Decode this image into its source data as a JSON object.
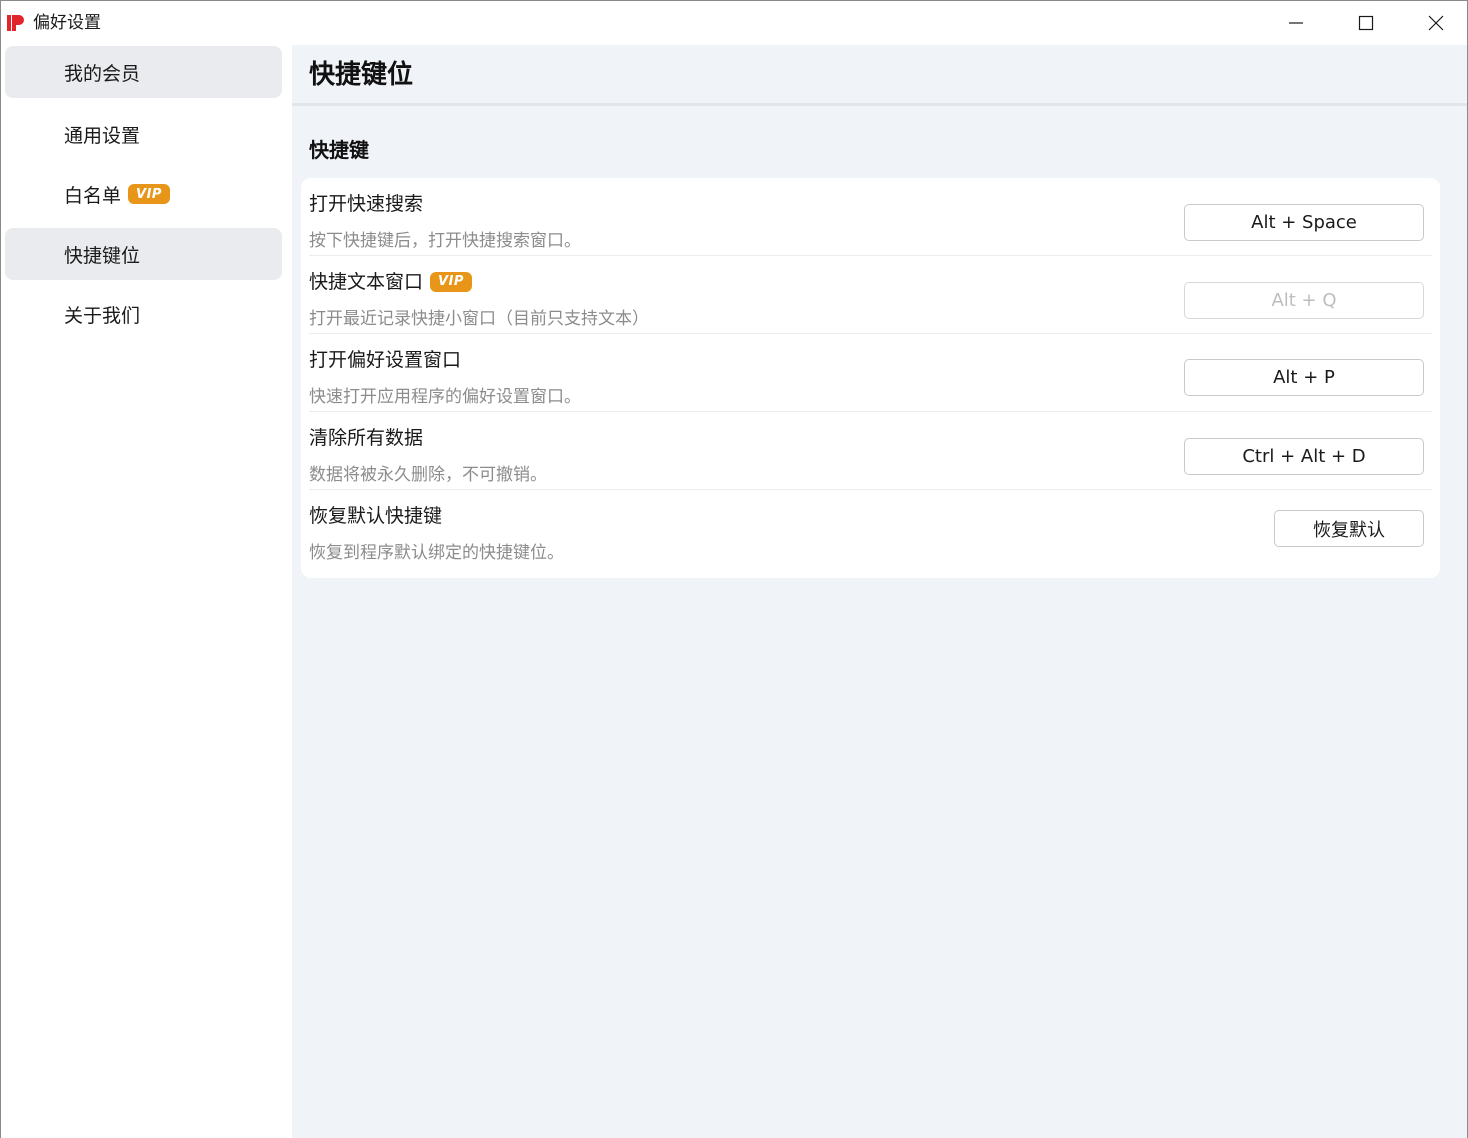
{
  "window": {
    "title": "偏好设置",
    "logo_icon": "app-logo-icon",
    "controls": {
      "minimize_icon": "minimize-icon",
      "maximize_icon": "maximize-icon",
      "close_icon": "close-icon"
    }
  },
  "sidebar": {
    "items": [
      {
        "label": "我的会员",
        "active": true
      },
      {
        "label": "通用设置",
        "active": false
      },
      {
        "label": "白名单",
        "active": false,
        "badge": "VIP"
      },
      {
        "label": "快捷键位",
        "active": true
      },
      {
        "label": "关于我们",
        "active": false
      }
    ]
  },
  "main": {
    "title": "快捷键位",
    "section_title": "快捷键",
    "shortcuts": [
      {
        "title": "打开快速搜索",
        "description": "按下快捷键后，打开快捷搜索窗口。",
        "key": "Alt + Space",
        "enabled": true
      },
      {
        "title": "快捷文本窗口",
        "badge": "VIP",
        "description": "打开最近记录快捷小窗口（目前只支持文本）",
        "key": "Alt + Q",
        "enabled": false
      },
      {
        "title": "打开偏好设置窗口",
        "description": "快速打开应用程序的偏好设置窗口。",
        "key": "Alt + P",
        "enabled": true
      },
      {
        "title": "清除所有数据",
        "description": "数据将被永久删除，不可撤销。",
        "key": "Ctrl + Alt + D",
        "enabled": true
      },
      {
        "title": "恢复默认快捷键",
        "description": "恢复到程序默认绑定的快捷键位。",
        "button": "恢复默认"
      }
    ]
  },
  "colors": {
    "accent_vip": "#e8961a",
    "main_bg": "#f0f4f8",
    "sidebar_active": "#e9ebee",
    "logo_red": "#e0262b"
  }
}
